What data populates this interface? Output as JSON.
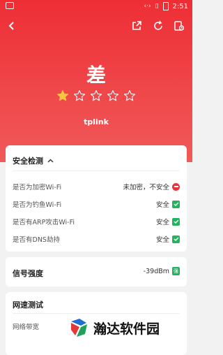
{
  "status_bar": {
    "time": "2:51"
  },
  "rating": {
    "word": "差",
    "score": 1,
    "max": 5
  },
  "network": {
    "ssid": "tplink"
  },
  "security": {
    "title": "安全检测",
    "rows": [
      {
        "label": "是否为加密Wi-Fi",
        "value": "未加密，不安全",
        "status": "bad"
      },
      {
        "label": "是否为钓鱼Wi-Fi",
        "value": "安全",
        "status": "ok"
      },
      {
        "label": "是否有ARP攻击Wi-Fi",
        "value": "安全",
        "status": "ok"
      },
      {
        "label": "是否有DNS劫持",
        "value": "安全",
        "status": "ok"
      }
    ]
  },
  "signal": {
    "title": "信号强度",
    "value": "-39dBm",
    "badge": "强"
  },
  "speed": {
    "title": "网速测试",
    "bandwidth_label": "网络带宽"
  },
  "watermark": {
    "text": "瀚达软件园"
  },
  "colors": {
    "accent": "#ee2e35",
    "ok": "#22b35e",
    "star": "#f6c343"
  }
}
